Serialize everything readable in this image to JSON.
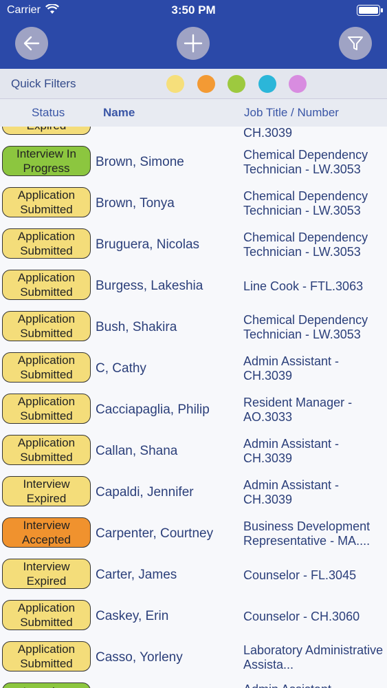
{
  "status_bar": {
    "carrier": "Carrier",
    "time": "3:50 PM"
  },
  "quick_filters": {
    "label": "Quick Filters",
    "colors": [
      "#f6df7b",
      "#f39a34",
      "#9dc93f",
      "#2bb6d9",
      "#d88ce0"
    ]
  },
  "columns": {
    "status": "Status",
    "name": "Name",
    "job": "Job Title / Number"
  },
  "status_colors": {
    "yellow": "#f4dd7a",
    "green": "#8cc63f",
    "orange": "#f0922e"
  },
  "rows": [
    {
      "status": "Expired",
      "name": "",
      "job": "CH.3039",
      "color": "yellow"
    },
    {
      "status": "Interview In Progress",
      "name": "Brown, Simone",
      "job": "Chemical Dependency Technician - LW.3053",
      "color": "green"
    },
    {
      "status": "Application Submitted",
      "name": "Brown, Tonya",
      "job": "Chemical Dependency Technician - LW.3053",
      "color": "yellow"
    },
    {
      "status": "Application Submitted",
      "name": "Bruguera, Nicolas",
      "job": "Chemical Dependency Technician - LW.3053",
      "color": "yellow"
    },
    {
      "status": "Application Submitted",
      "name": "Burgess, Lakeshia",
      "job": "Line Cook - FTL.3063",
      "color": "yellow"
    },
    {
      "status": "Application Submitted",
      "name": "Bush, Shakira",
      "job": "Chemical Dependency Technician - LW.3053",
      "color": "yellow"
    },
    {
      "status": "Application Submitted",
      "name": "C, Cathy",
      "job": "Admin Assistant - CH.3039",
      "color": "yellow"
    },
    {
      "status": "Application Submitted",
      "name": "Cacciapaglia, Philip",
      "job": "Resident Manager - AO.3033",
      "color": "yellow"
    },
    {
      "status": "Application Submitted",
      "name": "Callan, Shana",
      "job": "Admin Assistant - CH.3039",
      "color": "yellow"
    },
    {
      "status": "Interview Expired",
      "name": "Capaldi, Jennifer",
      "job": "Admin Assistant - CH.3039",
      "color": "yellow"
    },
    {
      "status": "Interview Accepted",
      "name": "Carpenter, Courtney",
      "job": "Business Development Representative - MA....",
      "color": "orange"
    },
    {
      "status": "Interview Expired",
      "name": "Carter, James",
      "job": "Counselor - FL.3045",
      "color": "yellow"
    },
    {
      "status": "Application Submitted",
      "name": "Caskey, Erin",
      "job": "Counselor - CH.3060",
      "color": "yellow"
    },
    {
      "status": "Application Submitted",
      "name": "Casso, Yorleny",
      "job": "Laboratory Administrative Assista...",
      "color": "yellow"
    },
    {
      "status": "Interview",
      "name": "",
      "job": "Admin Assistant -",
      "color": "green"
    }
  ]
}
